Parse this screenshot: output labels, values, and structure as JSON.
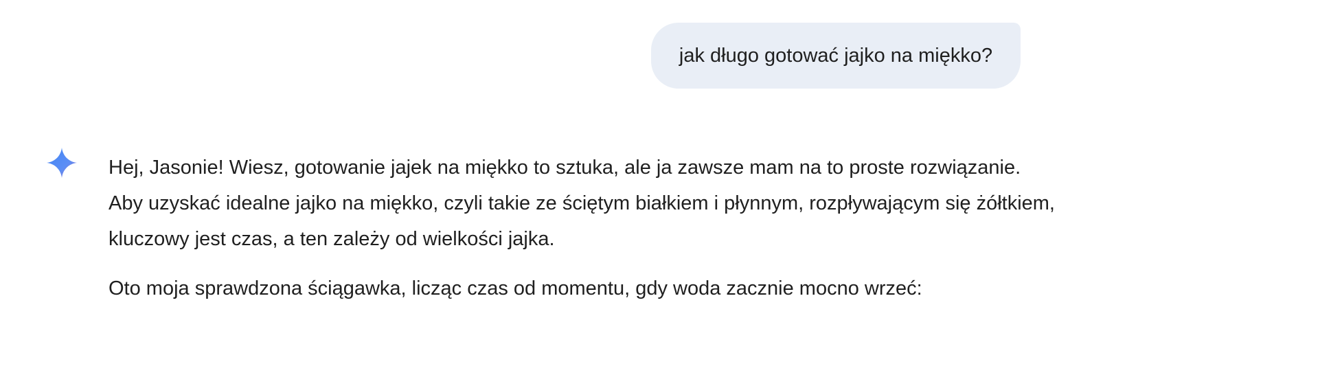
{
  "user_message": {
    "text": "jak długo gotować jajko na miękko?",
    "bubble_color": "#e9eef6"
  },
  "assistant": {
    "icon": "sparkle-icon",
    "icon_gradient": [
      "#4285f4",
      "#9b72cb"
    ],
    "paragraphs": [
      "Hej, Jasonie! Wiesz, gotowanie jajek na miękko to sztuka, ale ja zawsze mam na to proste rozwiązanie. Aby uzyskać idealne jajko na miękko, czyli takie ze ściętym białkiem i płynnym, rozpływającym się żółtkiem, kluczowy jest czas, a ten zależy od wielkości jajka.",
      "Oto moja sprawdzona ściągawka, licząc czas od momentu, gdy woda zacznie mocno wrzeć:"
    ]
  }
}
